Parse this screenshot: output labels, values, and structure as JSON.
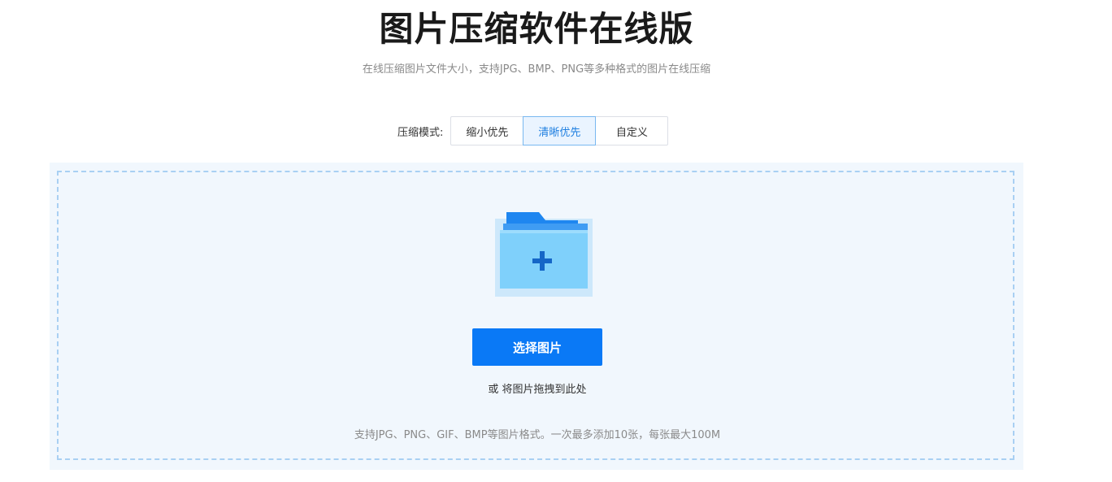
{
  "header": {
    "title": "图片压缩软件在线版",
    "subtitle": "在线压缩图片文件大小，支持JPG、BMP、PNG等多种格式的图片在线压缩"
  },
  "compression": {
    "label": "压缩模式:",
    "modes": [
      {
        "label": "缩小优先",
        "selected": false
      },
      {
        "label": "清晰优先",
        "selected": true
      },
      {
        "label": "自定义",
        "selected": false
      }
    ]
  },
  "upload": {
    "icon": "folder-add-icon",
    "button_label": "选择图片",
    "drag_hint": "或 将图片拖拽到此处",
    "format_hint": "支持JPG、PNG、GIF、BMP等图片格式。一次最多添加10张，每张最大100M"
  },
  "colors": {
    "accent": "#0a79f6",
    "selected_bg": "#eaf4ff",
    "upload_bg": "#f1f7fd",
    "dash_border": "#a9d0f3"
  }
}
